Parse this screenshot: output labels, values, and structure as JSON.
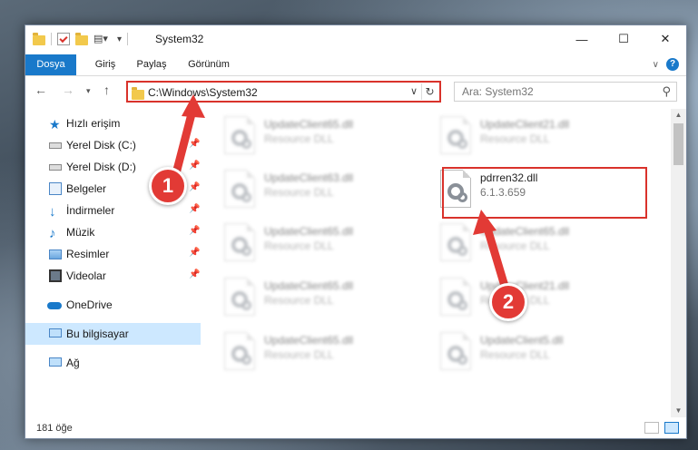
{
  "window": {
    "title": "System32"
  },
  "ribbon": {
    "tabs": [
      "Dosya",
      "Giriş",
      "Paylaş",
      "Görünüm"
    ]
  },
  "address": {
    "path": "C:\\Windows\\System32"
  },
  "search": {
    "placeholder": "Ara: System32"
  },
  "sidebar": {
    "items": [
      {
        "label": "Hızlı erişim"
      },
      {
        "label": "Yerel Disk (C:)"
      },
      {
        "label": "Yerel Disk (D:)"
      },
      {
        "label": "Belgeler"
      },
      {
        "label": "İndirmeler"
      },
      {
        "label": "Müzik"
      },
      {
        "label": "Resimler"
      },
      {
        "label": "Videolar"
      },
      {
        "label": "OneDrive"
      },
      {
        "label": "Bu bilgisayar"
      },
      {
        "label": "Ağ"
      }
    ]
  },
  "files": [
    {
      "name": "UpdateClient65.dll",
      "desc": "Resource DLL"
    },
    {
      "name": "UpdateClient21.dll",
      "desc": "Resource DLL"
    },
    {
      "name": "UpdateClient63.dll",
      "desc": "Resource DLL"
    },
    {
      "name": "pdrren32.dll",
      "desc": "6.1.3.659"
    },
    {
      "name": "UpdateClient65.dll",
      "desc": "Resource DLL"
    },
    {
      "name": "UpdateClient65.dll",
      "desc": "Resource DLL"
    },
    {
      "name": "UpdateClient65.dll",
      "desc": "Resource DLL"
    },
    {
      "name": "UpdateClient21.dll",
      "desc": "Resource DLL"
    },
    {
      "name": "UpdateClient65.dll",
      "desc": "Resource DLL"
    },
    {
      "name": "UpdateClient5.dll",
      "desc": "Resource DLL"
    }
  ],
  "status": {
    "count": "181 öğe"
  },
  "callouts": [
    "1",
    "2"
  ],
  "colors": {
    "accent": "#1979ca",
    "highlight": "#d9322b"
  }
}
